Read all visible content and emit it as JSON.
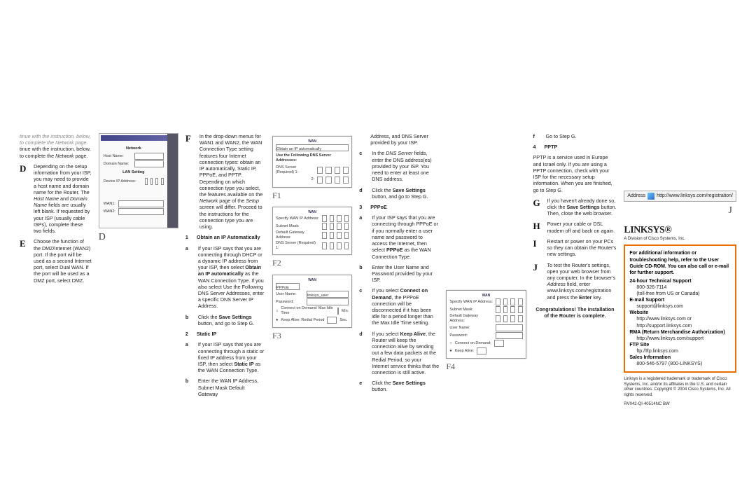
{
  "col1": {
    "d_pre": "tinue with the instruction, below, to complete the Network page.",
    "d": "Depending on the setup information from your ISP, you may need to provide a host name and domain name for the Router. The Host Name and Domain Name fields are usually left blank. If requested by your ISP (usually cable ISPs), complete these two fields.",
    "e": "Choose the function of the DMZ/Internet (WAN2) port. If the port will be used as a second Internet port, select Dual WAN. If the port will be used as a DMZ port, select DMZ."
  },
  "capD": "D",
  "col3": {
    "f": "In the drop-down menus for WAN1 and WAN2, the WAN Connection Type setting features four Internet connection types: obtain an IP automatically, Static IP, PPPoE, and PPTP. Depending on which connection type you select, the features available on the Network page of the Setup screen will differ. Proceed to the instructions for the connection type you are using.",
    "s1t": "Obtain an IP Automatically",
    "s1a": "If your ISP says that you are connecting through DHCP or a dynamic IP address from your ISP, then select Obtain an IP automatically as the WAN Connection Type. If you also select Use the Following DNS Server Addresses, enter a specific DNS Server IP Address.",
    "s1b": "Click the Save Settings button, and go to Step G.",
    "s2t": "Static IP",
    "s2a": "If your ISP says that you are connecting through a static or fixed IP address from your ISP, then select Static IP as the WAN Connection Type.",
    "s2b": "Enter the WAN IP Address, Subnet Mask Default Gateway"
  },
  "capF1": "F1",
  "capF2": "F2",
  "capF3": "F3",
  "capF4": "F4",
  "fig1": {
    "t": "Obtain an IP automatically",
    "chk": "Use the Following DNS Server Addresses:",
    "d1": "DNS Server (Required) 1:",
    "d2": "2:"
  },
  "fig2": {
    "t": "WAN",
    "l1": "Specify WAN IP Address:",
    "l2": "Subnet Mask:",
    "l3": "Default Gateway Address:",
    "l4": "DNS Server (Required) 1:"
  },
  "fig3": {
    "t": "WAN",
    "mode": "PPPoE",
    "l1": "User Name:",
    "l2": "Password:",
    "o1": "Connect on Demand: Max Idle Time",
    "o2": "Keep Alive: Redial Period",
    "v1": "linksys_user",
    "min": "Min.",
    "sec": "Sec."
  },
  "col5": {
    "top": "Address, and DNS Server provided by your ISP.",
    "c": "In the DNS Server fields, enter the DNS address(es) provided by your ISP. You need to enter at least one DNS address.",
    "d": "Click the Save Settings button, and go to Step G.",
    "s3t": "PPPoE",
    "s3a": "If your ISP says that you are connecting through PPPoE or if you normally enter a user name and password to access the Internet, then select PPPoE as the WAN Connection Type.",
    "s3b": "Enter the User Name and Password provided by your ISP.",
    "s3c": "If you select Connect on Demand, the PPPoE connection will be disconnected if it has been idle for a period longer than the Max Idle Time setting.",
    "s3d": "If you select Keep Alive, the Router will keep the connection alive by sending out a few data packets at the Redial Period, so your Internet service thinks that the connection is still active.",
    "s3e": "Click the Save Settings button."
  },
  "fig4": {
    "t": "WAN",
    "l1": "Specify WAN IP Address:",
    "l2": "Subnet Mask:",
    "l3": "Default Gateway Address:",
    "l4": "User Name:",
    "l5": "Password:",
    "o1": "Connect on Demand:",
    "o2": "Keep Alive:"
  },
  "col7": {
    "f": "Go to Step G.",
    "s4t": "PPTP",
    "s4": "PPTP is a service used in Europe and Israel only. If you are using a PPTP connection, check with your ISP for the necessary setup information. When you are finished, go to Step G.",
    "g": "If you haven't already done so, click the Save Settings button. Then, close the web browser.",
    "h": "Power your cable or DSL modem off and back on again.",
    "i": "Restart or power on your PCs so they can obtain the Router's new settings.",
    "j": "To test the Router's settings, open your web browser from any computer. In the browser's Address field, enter www.linksys.com/registration and press the Enter key.",
    "congrat": "Congratulations! The installation of the Router is complete."
  },
  "addr": {
    "lbl": "Address",
    "url": "http://www.linksys.com/registration/"
  },
  "capJ": "J",
  "logo": "LINKSYS®",
  "logosub": "A Division of Cisco Systems, Inc.",
  "orange": {
    "intro": "For additional information or troubleshooting help, refer to the User Guide CD-ROM. You can also call or e-mail for further support.",
    "l1": "24-hour Technical Support",
    "v1": "800-326-7114",
    "v1b": "(toll-free from US or Canada)",
    "l2": "E-mail Support",
    "v2": "support@linksys.com",
    "l3": "Website",
    "v3a": "http://www.linksys.com or",
    "v3b": "http://support.linksys.com",
    "l4": "RMA (Return Merchandise Authorization)",
    "v4": "http://www.linksys.com/support",
    "l5": "FTP Site",
    "v5": "ftp://ftp.linksys.com",
    "l6": "Sales Information",
    "v6": "800-546-5797 (800-LINKSYS)"
  },
  "trademark": "Linksys is a registered trademark or trademark of Cisco Systems, Inc. and/or its affiliates in the U.S. and certain other countries. Copyright © 2004 Cisco Systems, Inc. All rights reserved.",
  "partno": "RV042-QI-40514NC BW"
}
